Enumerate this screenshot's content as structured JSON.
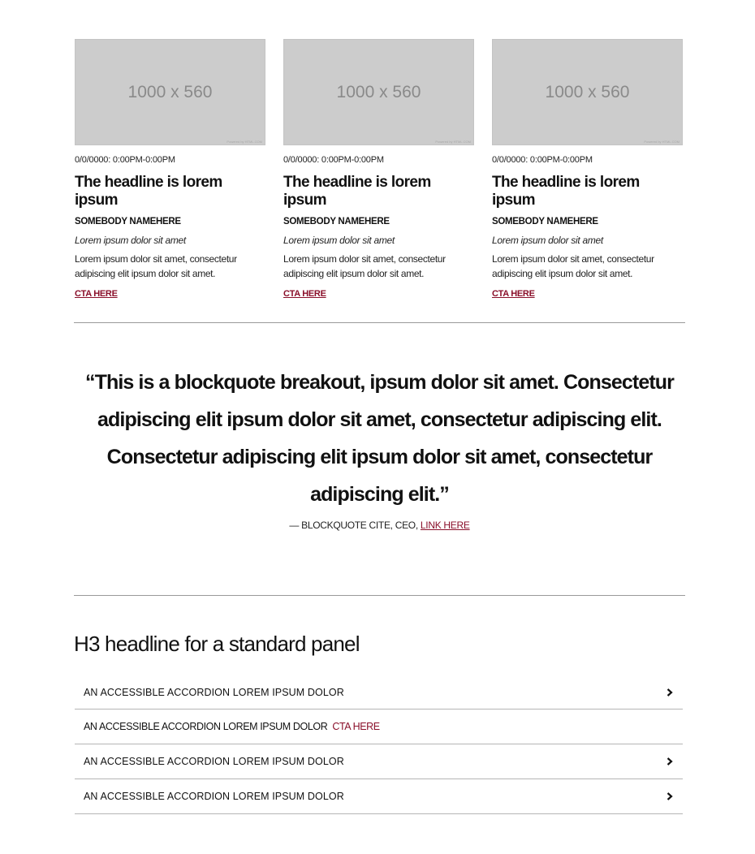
{
  "cards": [
    {
      "image_label": "1000 x 560",
      "image_credit": "Powered by HTML.COM",
      "date": "0/0/0000: 0:00PM-0:00PM",
      "headline": "The headline is lorem ipsum",
      "byline": "SOMEBODY NAMEHERE",
      "dek": "Lorem ipsum dolor sit amet",
      "body": "Lorem ipsum dolor sit amet, consectetur adipiscing elit ipsum dolor sit amet.",
      "cta": "CTA HERE"
    },
    {
      "image_label": "1000 x 560",
      "image_credit": "Powered by HTML.COM",
      "date": "0/0/0000: 0:00PM-0:00PM",
      "headline": "The headline is lorem ipsum",
      "byline": "SOMEBODY NAMEHERE",
      "dek": "Lorem ipsum dolor sit amet",
      "body": "Lorem ipsum dolor sit amet, consectetur adipiscing elit ipsum dolor sit amet.",
      "cta": "CTA HERE"
    },
    {
      "image_label": "1000 x 560",
      "image_credit": "Powered by HTML.COM",
      "date": "0/0/0000: 0:00PM-0:00PM",
      "headline": "The headline is lorem ipsum",
      "byline": "SOMEBODY NAMEHERE",
      "dek": "Lorem ipsum dolor sit amet",
      "body": "Lorem ipsum dolor sit amet, consectetur adipiscing elit ipsum dolor sit amet.",
      "cta": "CTA HERE"
    }
  ],
  "blockquote": {
    "text": "“This is a blockquote breakout, ipsum dolor sit amet. Consectetur adipiscing elit ipsum dolor sit amet, consectetur adipiscing elit. Consectetur adipiscing elit ipsum dolor sit amet, consectetur adipiscing elit.”",
    "cite": "— BLOCKQUOTE CITE, CEO,",
    "cite_link": "LINK HERE"
  },
  "panel": {
    "title": "H3 headline for a standard panel",
    "accordion": [
      {
        "label": "AN ACCESSIBLE ACCORDION LOREM IPSUM DOLOR",
        "icon": "chevron-right-icon"
      },
      {
        "label": "AN ACCESSIBLE ACCORDION LOREM IPSUM DOLOR",
        "cta": "CTA HERE"
      },
      {
        "label": "AN ACCESSIBLE ACCORDION LOREM IPSUM DOLOR",
        "icon": "chevron-right-icon"
      },
      {
        "label": "AN ACCESSIBLE ACCORDION LOREM IPSUM DOLOR",
        "icon": "chevron-right-icon"
      }
    ]
  },
  "colors": {
    "accent": "#8a0f2a",
    "placeholder_bg": "#cccccc",
    "rule": "#9a9a9a"
  }
}
